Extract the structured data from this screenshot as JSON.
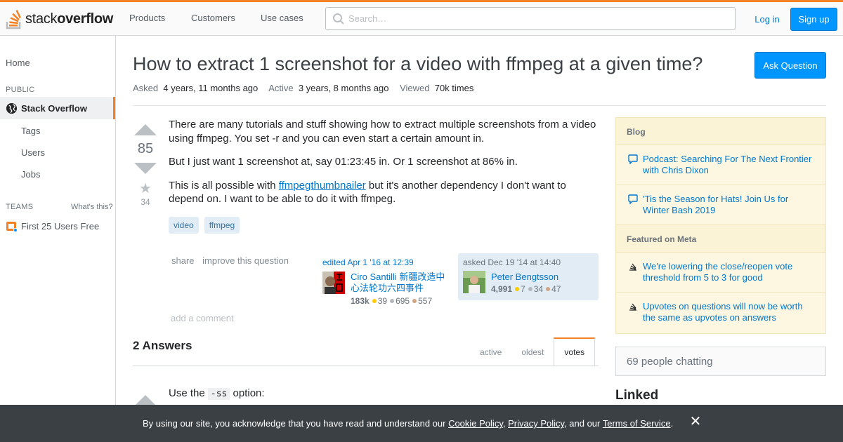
{
  "header": {
    "logo_text_plain": "stack",
    "logo_text_bold": "overflow",
    "nav": [
      "Products",
      "Customers",
      "Use cases"
    ],
    "search_placeholder": "Search…",
    "login_label": "Log in",
    "signup_label": "Sign up",
    "accent_color": "#f48024",
    "primary_color": "#0095ff"
  },
  "leftnav": {
    "home": "Home",
    "public_label": "PUBLIC",
    "stack_overflow": "Stack Overflow",
    "tags": "Tags",
    "users": "Users",
    "jobs": "Jobs",
    "teams_label": "TEAMS",
    "whats_this": "What's this?",
    "first_users": "First 25 Users Free"
  },
  "question": {
    "title": "How to extract 1 screenshot for a video with ffmpeg at a given time?",
    "ask_button": "Ask Question",
    "asked_label": "Asked",
    "asked_value": "4 years, 11 months ago",
    "active_label": "Active",
    "active_value": "3 years, 8 months ago",
    "viewed_label": "Viewed",
    "viewed_value": "70k times",
    "votes": "85",
    "favorites": "34",
    "p1": "There are many tutorials and stuff showing how to extract multiple screenshots from a video using ffmpeg. You set -r and you can even start a certain amount in.",
    "p2": "But I just want 1 screenshot at, say 01:23:45 in. Or 1 screenshot at 86% in.",
    "p3_pre": "This is all possible with ",
    "p3_link": "ffmpegthumbnailer",
    "p3_post": " but it's another dependency I don't want to depend on. I want to be able to do it with ffmpeg.",
    "tags": [
      "video",
      "ffmpeg"
    ],
    "menu_share": "share",
    "menu_improve": "improve this question",
    "editor": {
      "when": "edited Apr 1 '16 at 12:39",
      "name": "Ciro Santilli 新疆改造中心法轮功六四事件",
      "rep": "183k",
      "gold": "39",
      "silver": "695",
      "bronze": "557"
    },
    "asker": {
      "when": "asked Dec 19 '14 at 14:40",
      "name": "Peter Bengtsson",
      "rep": "4,991",
      "gold": "7",
      "silver": "34",
      "bronze": "47"
    },
    "add_comment": "add a comment"
  },
  "answers": {
    "heading": "2 Answers",
    "tabs": [
      "active",
      "oldest",
      "votes"
    ],
    "active_tab": "votes",
    "first_pre": "Use the ",
    "first_code": "-ss",
    "first_post": " option:"
  },
  "sidebar": {
    "blog_heading": "Blog",
    "blog_items": [
      "Podcast: Searching For The Next Frontier with Chris Dixon",
      "'Tis the Season for Hats! Join Us for Winter Bash 2019"
    ],
    "meta_heading": "Featured on Meta",
    "meta_items": [
      "We're lowering the close/reopen vote threshold from 5 to 3 for good",
      "Upvotes on questions will now be worth the same as upvotes on answers"
    ],
    "chat": "69 people chatting",
    "linked": "Linked"
  },
  "cookie": {
    "text_pre": "By using our site, you acknowledge that you have read and understand our ",
    "cookie_policy": "Cookie Policy",
    "sep1": ", ",
    "privacy_policy": "Privacy Policy",
    "sep2": ", and our ",
    "terms": "Terms of Service",
    "end": "."
  }
}
